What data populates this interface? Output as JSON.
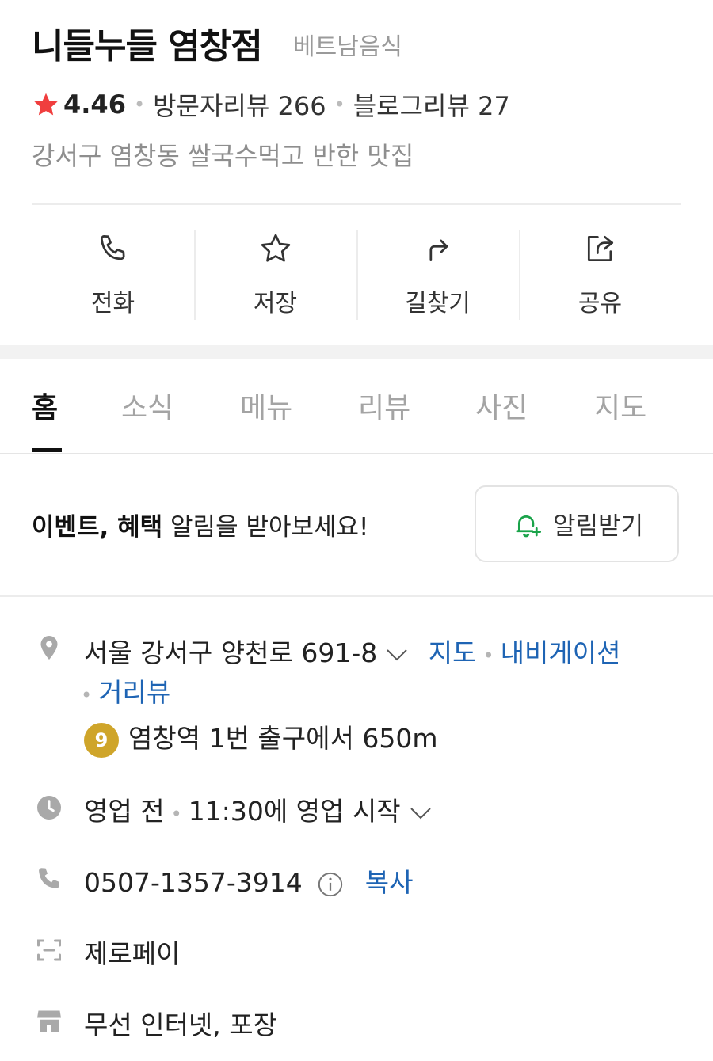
{
  "header": {
    "title": "니들누들 염창점",
    "category": "베트남음식",
    "rating": "4.46",
    "visitor_reviews": "방문자리뷰 266",
    "blog_reviews": "블로그리뷰 27",
    "tagline": "강서구 염창동 쌀국수먹고 반한 맛집"
  },
  "actions": [
    {
      "label": "전화",
      "icon": "phone-icon"
    },
    {
      "label": "저장",
      "icon": "star-outline-icon"
    },
    {
      "label": "길찾기",
      "icon": "directions-arrow-icon"
    },
    {
      "label": "공유",
      "icon": "share-icon"
    }
  ],
  "tabs": [
    "홈",
    "소식",
    "메뉴",
    "리뷰",
    "사진",
    "지도"
  ],
  "active_tab": "홈",
  "notice": {
    "text_bold": "이벤트, 혜택",
    "text_rest": " 알림을 받아보세요!",
    "button_label": "알림받기"
  },
  "info": {
    "address": "서울 강서구 양천로 691-8",
    "address_links": [
      "지도",
      "내비게이션",
      "거리뷰"
    ],
    "subway_line": "9",
    "subway_text": "염창역 1번 출구에서 650m",
    "hours_status": "영업 전",
    "hours_detail": "11:30에 영업 시작",
    "phone": "0507-1357-3914",
    "copy_label": "복사",
    "payment": "제로페이",
    "amenities": "무선 인터넷, 포장"
  },
  "colors": {
    "star": "#f03e3e",
    "link": "#1e64b4",
    "bell": "#1aa34a",
    "subway_line_9": "#cfa52a",
    "icon_gray": "#a9a9a9"
  }
}
